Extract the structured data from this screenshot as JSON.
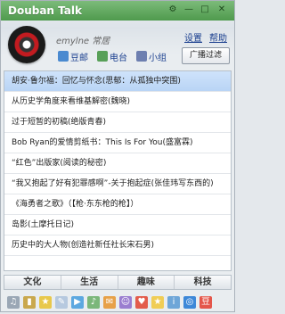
{
  "app": {
    "title": "Douban Talk"
  },
  "header": {
    "username": "emylne 常居",
    "settings_label": "设置",
    "help_label": "帮助",
    "broadcast_filter_label": "广播过滤",
    "mode_tabs": [
      {
        "label": "豆邮",
        "icon": "mail-icon"
      },
      {
        "label": "电台",
        "icon": "radio-icon"
      },
      {
        "label": "小组",
        "icon": "group-icon"
      }
    ]
  },
  "list": {
    "items": [
      "胡安·鲁尔福：回忆与怀念(思郁：从孤独中突围)",
      "从历史学角度来看维基解密(魏晓)",
      "过于短暂的初稿(绝版青春)",
      "Bob Ryan的爱情剪纸书：This Is For You(盛富霖)",
      "“红色”出版家(阅读的秘密)",
      "“我又抱起了好有犯罪感啊”-关于抱起症(张佳玮写东西的)",
      "《海勇者之歌》（【枪·东东枪的枪】）",
      "岛影(土摩托日记)",
      "历史中的大人物(创造社新任社长宋石男)"
    ]
  },
  "categories": [
    "文化",
    "生活",
    "趣味",
    "科技"
  ],
  "toolbar": {
    "icons": [
      "speaker-icon",
      "folder-icon",
      "star-icon",
      "note-icon",
      "play-icon",
      "music-icon",
      "chat-icon",
      "user-icon",
      "heart-icon",
      "star-filled-icon",
      "info-icon",
      "globe-icon",
      "douban-icon"
    ]
  },
  "colors": {
    "titlebar": "#5aa357",
    "link": "#1a3f8f",
    "selected_row": "#c6dcf8"
  }
}
